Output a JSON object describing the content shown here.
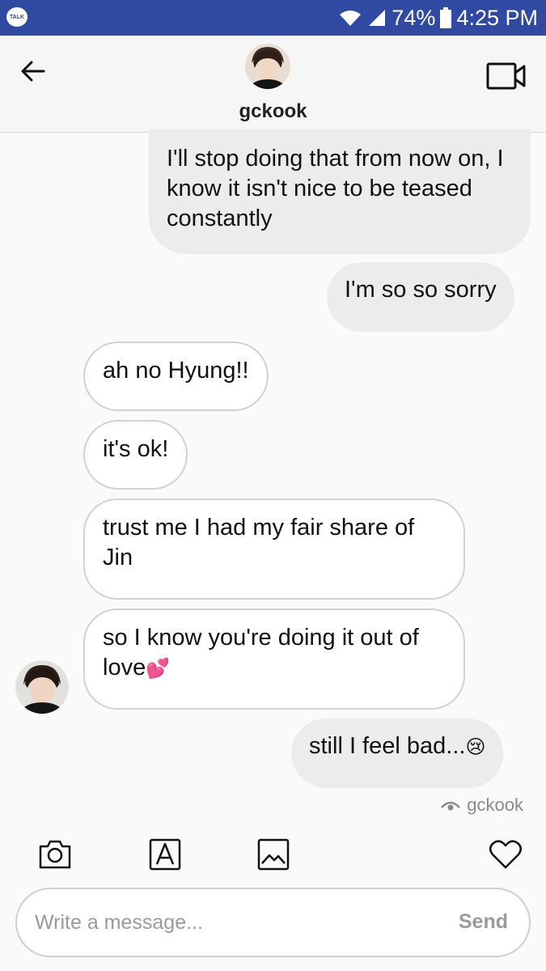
{
  "status_bar": {
    "app_badge": "TALK",
    "battery": "74%",
    "time": "4:25 PM"
  },
  "header": {
    "back_icon": "arrow-left-icon",
    "username": "gckook",
    "video_icon": "video-camera-icon"
  },
  "messages": [
    {
      "direction": "outgoing",
      "text": "I'll stop doing that from now on, I know it isn't nice to be teased constantly"
    },
    {
      "direction": "outgoing",
      "text": "I'm so so sorry"
    },
    {
      "direction": "incoming",
      "text": "ah no Hyung!!"
    },
    {
      "direction": "incoming",
      "text": "it's ok!"
    },
    {
      "direction": "incoming",
      "text": "trust me I had my fair share of Jin"
    },
    {
      "direction": "incoming",
      "text": "so I know you're doing it out of love",
      "emoji": "💕"
    },
    {
      "direction": "outgoing",
      "text": "still I feel bad...",
      "emoji": "😢"
    }
  ],
  "seen_by": "gckook",
  "toolbar": {
    "icons": [
      "camera-icon",
      "text-format-icon",
      "gallery-icon",
      "heart-icon"
    ]
  },
  "composer": {
    "placeholder": "Write a message...",
    "value": "",
    "send_label": "Send"
  },
  "colors": {
    "status_bar": "#2f4aa0",
    "outgoing_bubble": "#ececec",
    "incoming_bubble": "#ffffff"
  }
}
